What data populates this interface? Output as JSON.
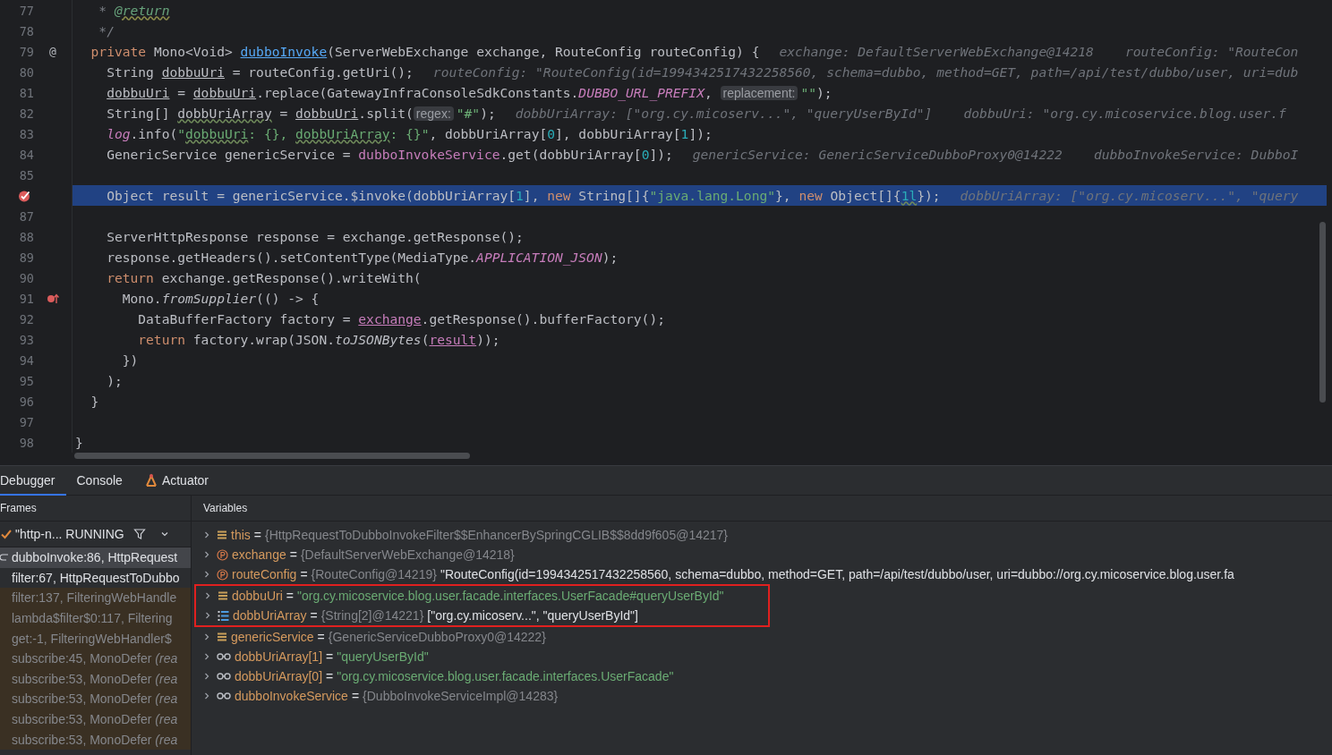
{
  "editor": {
    "lines": [
      {
        "num": "77",
        "kind": "plain",
        "tokens": [
          {
            "text": "   * ",
            "kind": "comment"
          },
          {
            "text": "@return",
            "kind": "doc_tag"
          }
        ]
      },
      {
        "num": "78",
        "kind": "plain",
        "tokens": [
          {
            "text": "   */",
            "kind": "comment"
          }
        ]
      },
      {
        "num": "79",
        "kind": "plain",
        "marker": "@",
        "tokens": [
          {
            "text": "  private",
            "kind": "keyword"
          },
          {
            "text": " Mono<Void> ",
            "kind": "plain"
          },
          {
            "text": "dubboInvoke",
            "kind": "method_decl"
          },
          {
            "text": "(ServerWebExchange exchange, RouteConfig routeConfig) {",
            "kind": "plain"
          },
          {
            "text": "exchange: DefaultServerWebExchange@14218    routeConfig: \"RouteCon",
            "kind": "hint"
          }
        ]
      },
      {
        "num": "80",
        "kind": "plain",
        "tokens": [
          {
            "text": "    String ",
            "kind": "plain"
          },
          {
            "text": "dobbuUri",
            "kind": "reassigned"
          },
          {
            "text": " = routeConfig.getUri();",
            "kind": "plain"
          },
          {
            "text": "routeConfig: \"RouteConfig(id=1994342517432258560, schema=dubbo, method=GET, path=/api/test/dubbo/user, uri=dub",
            "kind": "hint"
          }
        ]
      },
      {
        "num": "81",
        "kind": "plain",
        "tokens": [
          {
            "text": "    dobbuUri",
            "kind": "reassigned"
          },
          {
            "text": " = ",
            "kind": "plain"
          },
          {
            "text": "dobbuUri",
            "kind": "reassigned"
          },
          {
            "text": ".replace(GatewayInfraConsoleSdkConstants.",
            "kind": "plain"
          },
          {
            "text": "DUBBO_URL_PREFIX",
            "kind": "static_field"
          },
          {
            "text": ", ",
            "kind": "plain"
          },
          {
            "text": "replacement:",
            "kind": "inlay"
          },
          {
            "text": "\"\"",
            "kind": "string"
          },
          {
            "text": ");",
            "kind": "plain"
          }
        ]
      },
      {
        "num": "82",
        "kind": "plain",
        "tokens": [
          {
            "text": "    String[] ",
            "kind": "plain"
          },
          {
            "text": "dobbUriArray",
            "kind": "typo"
          },
          {
            "text": " = ",
            "kind": "plain"
          },
          {
            "text": "dobbuUri",
            "kind": "reassigned"
          },
          {
            "text": ".split(",
            "kind": "plain"
          },
          {
            "text": "regex:",
            "kind": "inlay"
          },
          {
            "text": "\"#\"",
            "kind": "string"
          },
          {
            "text": ");",
            "kind": "plain"
          },
          {
            "text": "dobbUriArray: [\"org.cy.micoserv...\", \"queryUserById\"]    dobbuUri: \"org.cy.micoservice.blog.user.f",
            "kind": "hint"
          }
        ]
      },
      {
        "num": "83",
        "kind": "plain",
        "tokens": [
          {
            "text": "    log",
            "kind": "static_field"
          },
          {
            "text": ".info(",
            "kind": "plain"
          },
          {
            "text": "\"",
            "kind": "string"
          },
          {
            "text": "dobbuUri",
            "kind": "string_typo"
          },
          {
            "text": ": {}, ",
            "kind": "string"
          },
          {
            "text": "dobbUriArray",
            "kind": "string_typo"
          },
          {
            "text": ": {}\"",
            "kind": "string"
          },
          {
            "text": ", dobbUriArray[",
            "kind": "plain"
          },
          {
            "text": "0",
            "kind": "number"
          },
          {
            "text": "], dobbUriArray[",
            "kind": "plain"
          },
          {
            "text": "1",
            "kind": "number"
          },
          {
            "text": "]);",
            "kind": "plain"
          }
        ]
      },
      {
        "num": "84",
        "kind": "plain",
        "tokens": [
          {
            "text": "    GenericService genericService = ",
            "kind": "plain"
          },
          {
            "text": "dubboInvokeService",
            "kind": "field"
          },
          {
            "text": ".get(dobbUriArray[",
            "kind": "plain"
          },
          {
            "text": "0",
            "kind": "number"
          },
          {
            "text": "]);",
            "kind": "plain"
          },
          {
            "text": "genericService: GenericServiceDubboProxy0@14222    dubboInvokeService: DubboI",
            "kind": "hint"
          }
        ]
      },
      {
        "num": "85",
        "kind": "plain"
      },
      {
        "kind": "breakpoint",
        "current": true,
        "tokens": [
          {
            "text": "    Object result = genericService.$invoke(dobbUriArray[",
            "kind": "plain"
          },
          {
            "text": "1",
            "kind": "number"
          },
          {
            "text": "], ",
            "kind": "plain"
          },
          {
            "text": "new",
            "kind": "keyword"
          },
          {
            "text": " String[]{",
            "kind": "plain"
          },
          {
            "text": "\"java.lang.Long\"",
            "kind": "string"
          },
          {
            "text": "}, ",
            "kind": "plain"
          },
          {
            "text": "new",
            "kind": "keyword"
          },
          {
            "text": " Object[]{",
            "kind": "plain"
          },
          {
            "text": "1l",
            "kind": "number_typo"
          },
          {
            "text": "});",
            "kind": "plain"
          },
          {
            "text": "dobbUriArray: [\"org.cy.micoserv...\", \"query",
            "kind": "hint"
          }
        ]
      },
      {
        "num": "87",
        "kind": "plain"
      },
      {
        "num": "88",
        "kind": "plain",
        "tokens": [
          {
            "text": "    ServerHttpResponse response = exchange.getResponse();",
            "kind": "plain"
          }
        ]
      },
      {
        "num": "89",
        "kind": "plain",
        "tokens": [
          {
            "text": "    response.getHeaders().setContentType(MediaType.",
            "kind": "plain"
          },
          {
            "text": "APPLICATION_JSON",
            "kind": "static_field"
          },
          {
            "text": ");",
            "kind": "plain"
          }
        ]
      },
      {
        "num": "90",
        "kind": "plain",
        "tokens": [
          {
            "text": "    return",
            "kind": "keyword"
          },
          {
            "text": " exchange.getResponse().writeWith(",
            "kind": "plain"
          }
        ]
      },
      {
        "num": "91",
        "kind": "lambda_breakpoint",
        "tokens": [
          {
            "text": "      Mono.",
            "kind": "plain"
          },
          {
            "text": "fromSupplier",
            "kind": "static_call"
          },
          {
            "text": "(() -> {",
            "kind": "plain"
          }
        ]
      },
      {
        "num": "92",
        "kind": "plain",
        "tokens": [
          {
            "text": "        DataBufferFactory factory = ",
            "kind": "plain"
          },
          {
            "text": "exchange",
            "kind": "captured"
          },
          {
            "text": ".getResponse().bufferFactory();",
            "kind": "plain"
          }
        ]
      },
      {
        "num": "93",
        "kind": "plain",
        "tokens": [
          {
            "text": "        return",
            "kind": "keyword"
          },
          {
            "text": " factory.wrap(JSON.",
            "kind": "plain"
          },
          {
            "text": "toJSONBytes",
            "kind": "static_call"
          },
          {
            "text": "(",
            "kind": "plain"
          },
          {
            "text": "result",
            "kind": "captured"
          },
          {
            "text": "));",
            "kind": "plain"
          }
        ]
      },
      {
        "num": "94",
        "kind": "plain",
        "tokens": [
          {
            "text": "      })",
            "kind": "plain"
          }
        ]
      },
      {
        "num": "95",
        "kind": "plain",
        "tokens": [
          {
            "text": "    );",
            "kind": "plain"
          }
        ]
      },
      {
        "num": "96",
        "kind": "plain",
        "tokens": [
          {
            "text": "  }",
            "kind": "plain"
          }
        ]
      },
      {
        "num": "97",
        "kind": "plain"
      },
      {
        "num": "98",
        "kind": "plain",
        "tokens": [
          {
            "text": "}",
            "kind": "plain"
          }
        ]
      }
    ]
  },
  "debug_panel": {
    "tabs": [
      {
        "label": "Debugger",
        "kind": "plain",
        "selected": true
      },
      {
        "label": "Console",
        "kind": "plain",
        "selected": false
      },
      {
        "label": "Actuator",
        "kind": "actuator",
        "selected": false
      }
    ],
    "frames": {
      "title": "Frames",
      "thread": "\"http-n... RUNNING",
      "items": [
        {
          "text": "dubboInvoke:86, HttpRequest",
          "kind": "current",
          "selected": true
        },
        {
          "text": "filter:67, HttpRequestToDubbo",
          "kind": "app",
          "selected": false
        },
        {
          "text": "filter:137, FilteringWebHandle",
          "kind": "library",
          "selected": false
        },
        {
          "text": "lambda$filter$0:117, Filtering",
          "kind": "library",
          "selected": false
        },
        {
          "text": "get:-1, FilteringWebHandler$",
          "kind": "library",
          "selected": false
        },
        {
          "text": "subscribe:45, MonoDefer *(rea*",
          "kind": "library",
          "selected": false
        },
        {
          "text": "subscribe:53, MonoDefer *(rea*",
          "kind": "library",
          "selected": false
        },
        {
          "text": "subscribe:53, MonoDefer *(rea*",
          "kind": "library",
          "selected": false
        },
        {
          "text": "subscribe:53, MonoDefer *(rea*",
          "kind": "library",
          "selected": false
        },
        {
          "text": "subscribe:53, MonoDefer *(rea*",
          "kind": "library",
          "selected": false
        }
      ]
    },
    "variables": {
      "title": "Variables",
      "items": [
        {
          "kind": "field",
          "name": "this",
          "operator": "=",
          "type": "{HttpRequestToDubboInvokeFilter$$EnhancerBySpringCGLIB$$8dd9f605@14217}",
          "highlighted": false
        },
        {
          "kind": "param",
          "name": "exchange",
          "operator": "=",
          "type": "{DefaultServerWebExchange@14218}",
          "highlighted": false
        },
        {
          "kind": "param",
          "name": "routeConfig",
          "operator": "=",
          "type": "{RouteConfig@14219}",
          "value": "\"RouteConfig(id=1994342517432258560, schema=dubbo, method=GET, path=/api/test/dubbo/user, uri=dubbo://org.cy.micoservice.blog.user.fa",
          "highlighted": false
        },
        {
          "kind": "field",
          "name": "dobbuUri",
          "operator": "=",
          "string": "\"org.cy.micoservice.blog.user.facade.interfaces.UserFacade#queryUserById\"",
          "highlighted": true
        },
        {
          "kind": "array",
          "name": "dobbUriArray",
          "operator": "=",
          "type": "{String[2]@14221}",
          "value": "[\"org.cy.micoserv...\", \"queryUserById\"]",
          "highlighted": true
        },
        {
          "kind": "field",
          "name": "genericService",
          "operator": "=",
          "type": "{GenericServiceDubboProxy0@14222}",
          "highlighted": false
        },
        {
          "kind": "watch",
          "name": "dobbUriArray[1]",
          "operator": "=",
          "string": "\"queryUserById\"",
          "highlighted": false
        },
        {
          "kind": "watch",
          "name": "dobbUriArray[0]",
          "operator": "=",
          "string": "\"org.cy.micoservice.blog.user.facade.interfaces.UserFacade\"",
          "highlighted": false
        },
        {
          "kind": "watch",
          "name": "dubboInvokeService",
          "operator": "=",
          "type": "{DubboInvokeServiceImpl@14283}",
          "highlighted": false
        }
      ]
    }
  }
}
